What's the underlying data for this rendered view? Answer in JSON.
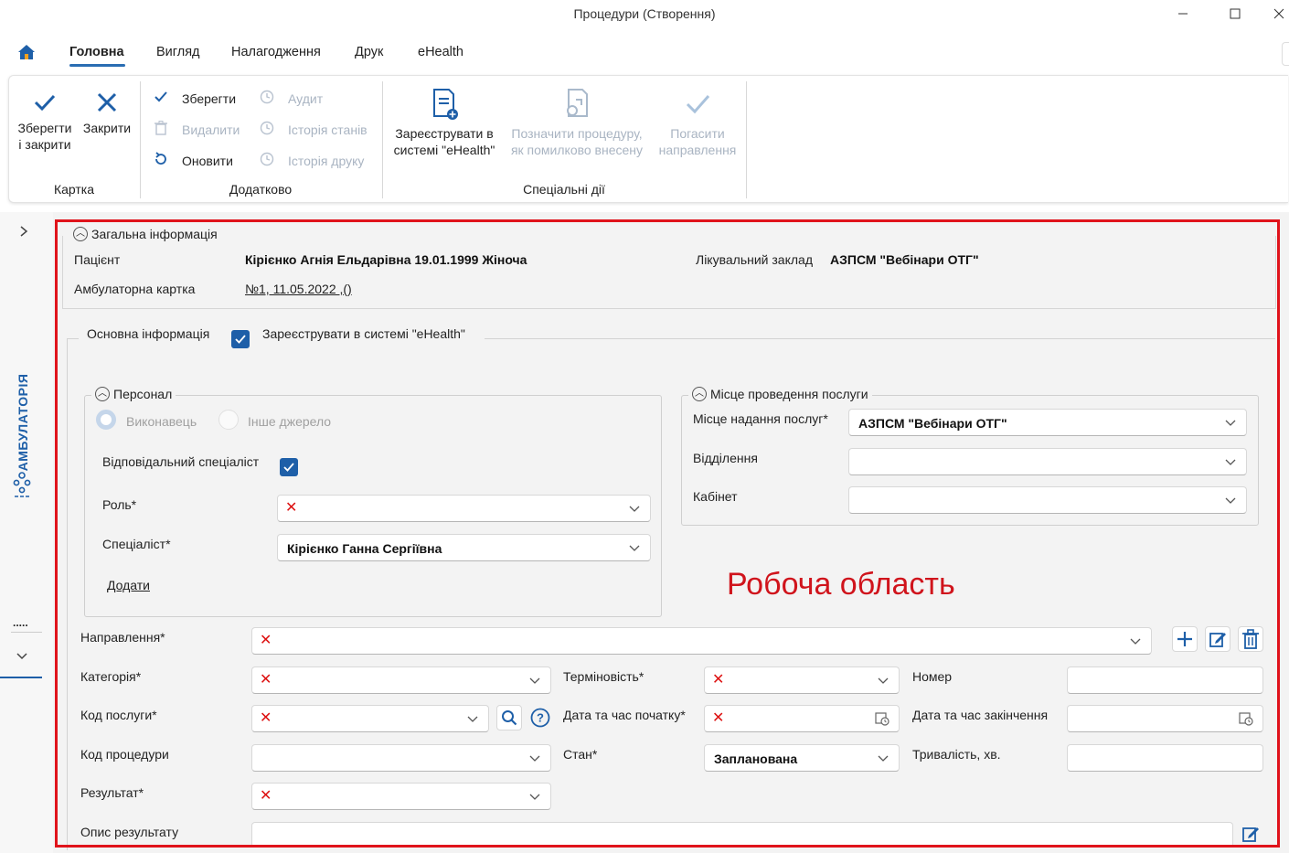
{
  "window": {
    "title": "Процедури (Створення)"
  },
  "menu": {
    "tabs": [
      "Головна",
      "Вигляд",
      "Налагодження",
      "Друк",
      "eHealth"
    ]
  },
  "ribbon": {
    "card": {
      "save_close": [
        "Зберегти",
        "і закрити"
      ],
      "close": "Закрити",
      "label": "Картка"
    },
    "extra": {
      "save": "Зберегти",
      "delete": "Видалити",
      "refresh": "Оновити",
      "audit": "Аудит",
      "state_history": "Історія станів",
      "print_history": "Історія друку",
      "label": "Додатково"
    },
    "special": {
      "register": [
        "Зареєструвати в",
        "системі \"eHealth\""
      ],
      "mark_error": [
        "Позначити процедуру,",
        "як помилково внесену"
      ],
      "cancel_referral": [
        "Погасити",
        "направлення"
      ],
      "label": "Спеціальні дії"
    }
  },
  "sidebar": {
    "label": "АМБУЛАТОРІЯ",
    "dots": "....."
  },
  "general": {
    "title": "Загальна інформація",
    "patient_label": "Пацієнт",
    "patient_value": "Кірієнко Агнія Ельдарівна 19.01.1999 Жіноча",
    "facility_label": "Лікувальний заклад",
    "facility_value": "АЗПСМ \"Вебінари ОТГ\"",
    "card_label": "Амбулаторна картка",
    "card_value": "№1, 11.05.2022 ,()"
  },
  "main": {
    "tab_label": "Основна інформація",
    "register_label": "Зареєструвати в системі \"eHealth\"",
    "register_checked": true
  },
  "personnel": {
    "title": "Персонал",
    "radio_performer": "Виконавець",
    "radio_other": "Інше джерело",
    "responsible_label": "Відповідальний спеціаліст",
    "responsible_checked": true,
    "role_label": "Роль*",
    "specialist_label": "Спеціаліст*",
    "specialist_value": "Кірієнко Ганна Сергіївна",
    "add_link": "Додати"
  },
  "place": {
    "title": "Місце проведення послуги",
    "place_label": "Місце надання послуг*",
    "place_value": "АЗПСМ \"Вебінари ОТГ\"",
    "department_label": "Відділення",
    "cabinet_label": "Кабінет"
  },
  "workarea_label": "Робоча область",
  "form": {
    "referral_label": "Направлення*",
    "category_label": "Категорія*",
    "urgency_label": "Терміновість*",
    "number_label": "Номер",
    "service_code_label": "Код послуги*",
    "start_label": "Дата та час початку*",
    "end_label": "Дата та час закінчення",
    "procedure_code_label": "Код процедури",
    "state_label": "Стан*",
    "state_value": "Запланована",
    "duration_label": "Тривалість, хв.",
    "result_label": "Результат*",
    "result_desc_label": "Опис результату"
  },
  "colors": {
    "accent": "#1e5fa8",
    "frame": "#e0131b",
    "workarea_text": "#d0141c",
    "error_x": "#d11111"
  }
}
